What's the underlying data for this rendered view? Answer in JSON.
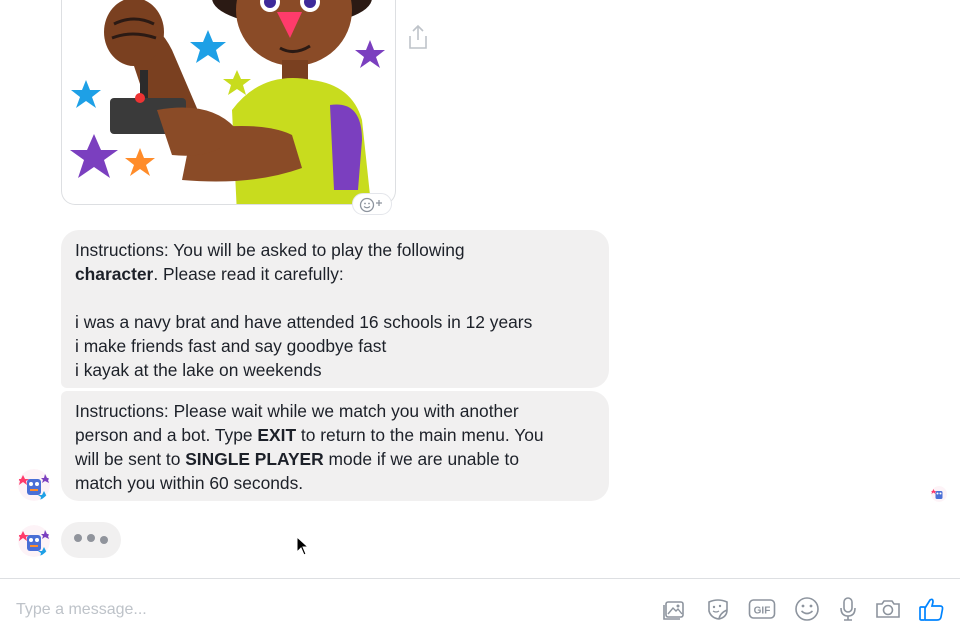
{
  "messages": [
    {
      "line1_pre": "Instructions: You will be asked to play the following",
      "line2_bold": "character",
      "line2_post": ". Please read it carefully:",
      "persona": [
        "i was a navy brat and have attended 16 schools in 12 years",
        "i make friends fast and say goodbye fast",
        "i kayak at the lake on weekends"
      ]
    },
    {
      "line1": "Instructions: Please wait while we match you with another",
      "line2_pre": "person and a bot. Type ",
      "line2_bold": "EXIT",
      "line2_post": " to return to the main menu. You",
      "line3_pre": "will be sent to ",
      "line3_bold": "SINGLE PLAYER",
      "line3_post": " mode if we are unable to",
      "line4": "match you within 60 seconds."
    }
  ],
  "composer": {
    "placeholder": "Type a message...",
    "icons": [
      "photo-icon",
      "sticker-icon",
      "gif-icon",
      "emoji-icon",
      "microphone-icon",
      "camera-icon",
      "thumbs-up-icon"
    ],
    "gif_label": "GIF"
  },
  "colors": {
    "bubble": "#f1f0f0",
    "accent": "#0084ff",
    "icon": "#8d949e"
  }
}
